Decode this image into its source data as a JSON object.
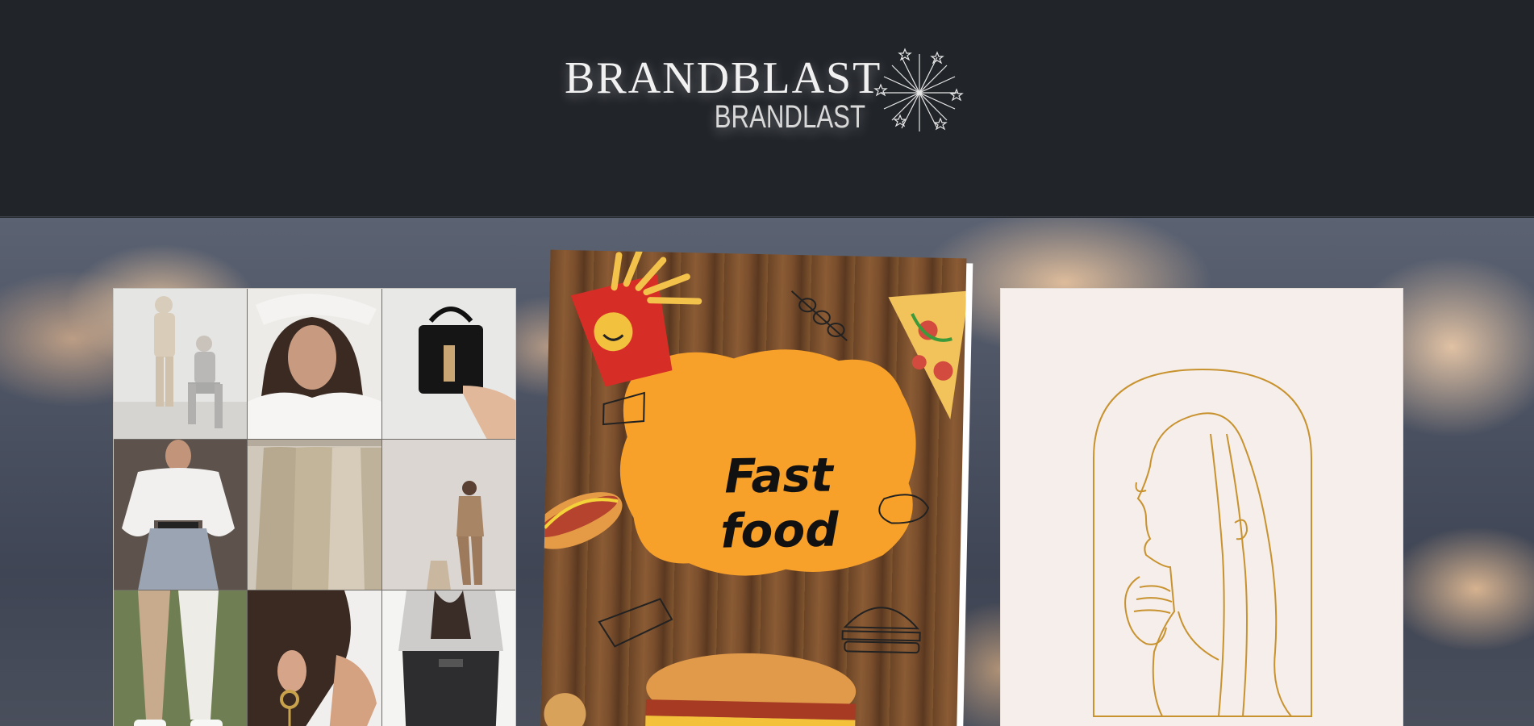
{
  "header": {
    "brand_name": "BRANDBLAST",
    "brand_subtitle": "BRANDLAST"
  },
  "cards": {
    "fashion_grid": {
      "tiles": [
        "two-models-beige-outfits",
        "woman-white-shirt-portrait",
        "black-handbag",
        "white-puff-sleeve-blouse",
        "beige-clothes-on-rack",
        "woman-in-brown-suit",
        "two-pairs-of-trousers",
        "gold-earring-closeup",
        "black-jeans-grey-sweater"
      ]
    },
    "flyer": {
      "title": "Fast food"
    },
    "line_art": {
      "subject": "woman-profile-in-arch"
    }
  },
  "colors": {
    "header_bg": "#212429",
    "flyer_splash": "#f7a02a",
    "line_art_stroke": "#c8922f",
    "line_art_bg": "#f5eeea"
  }
}
